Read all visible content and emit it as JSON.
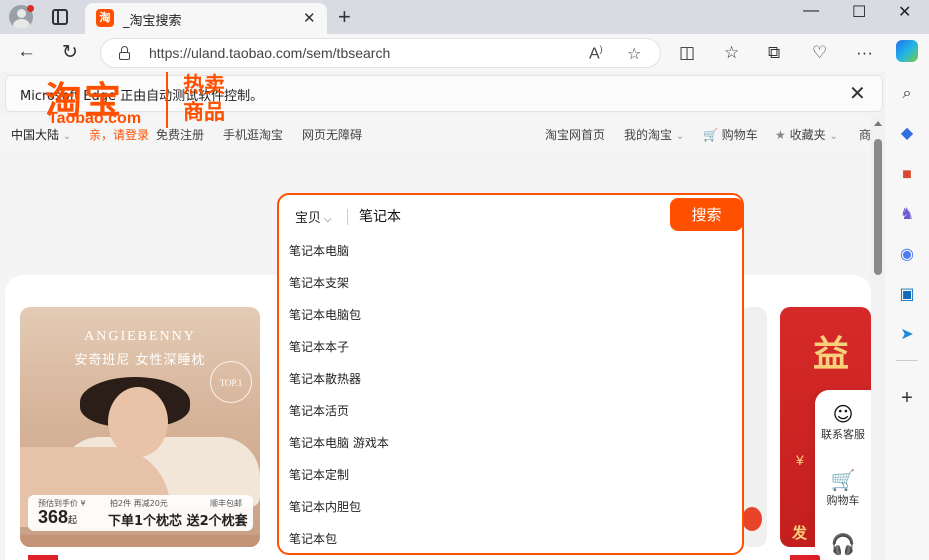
{
  "browser": {
    "tab_title": "_淘宝搜索",
    "tab_favicon_text": "淘",
    "url": "https://uland.taobao.com/sem/tbsearch",
    "automation_message": "Microsoft Edge 正由自动测试软件控制。"
  },
  "site_nav": {
    "region": "中国大陆",
    "greeting": "亲，请登录",
    "register": "免费注册",
    "mobile": "手机逛淘宝",
    "accessible": "网页无障碍",
    "home": "淘宝网首页",
    "my_taobao": "我的淘宝",
    "cart": "购物车",
    "favorites": "收藏夹",
    "more": "商"
  },
  "logo": {
    "cn": "淘宝",
    "en": "Taobao.com",
    "tagline": "热卖商品"
  },
  "search": {
    "category": "宝贝",
    "query": "笔记本",
    "button": "搜索",
    "suggestions": [
      "笔记本电脑",
      "笔记本支架",
      "笔记本电脑包",
      "笔记本本子",
      "笔记本散热器",
      "笔记本活页",
      "笔记本电脑 游戏本",
      "笔记本定制",
      "笔记本内胆包",
      "笔记本包"
    ]
  },
  "product_left": {
    "brand": "ANGIEBENNY",
    "subtitle": "安奇班尼 女性深睡枕",
    "badge": "TOP.1",
    "price_label": "预估到手价 ¥",
    "price": "368",
    "price_unit": "起",
    "promo": "拍2件 再减20元",
    "shipping": "顺丰包邮",
    "headline": "下单1个枕芯 送2个枕套"
  },
  "product_right": {
    "title": "益",
    "money": "¥",
    "bottom": "发"
  },
  "float_panel": {
    "service": "联系客服",
    "cart": "购物车"
  },
  "colors": {
    "brand_orange": "#ff5000"
  }
}
